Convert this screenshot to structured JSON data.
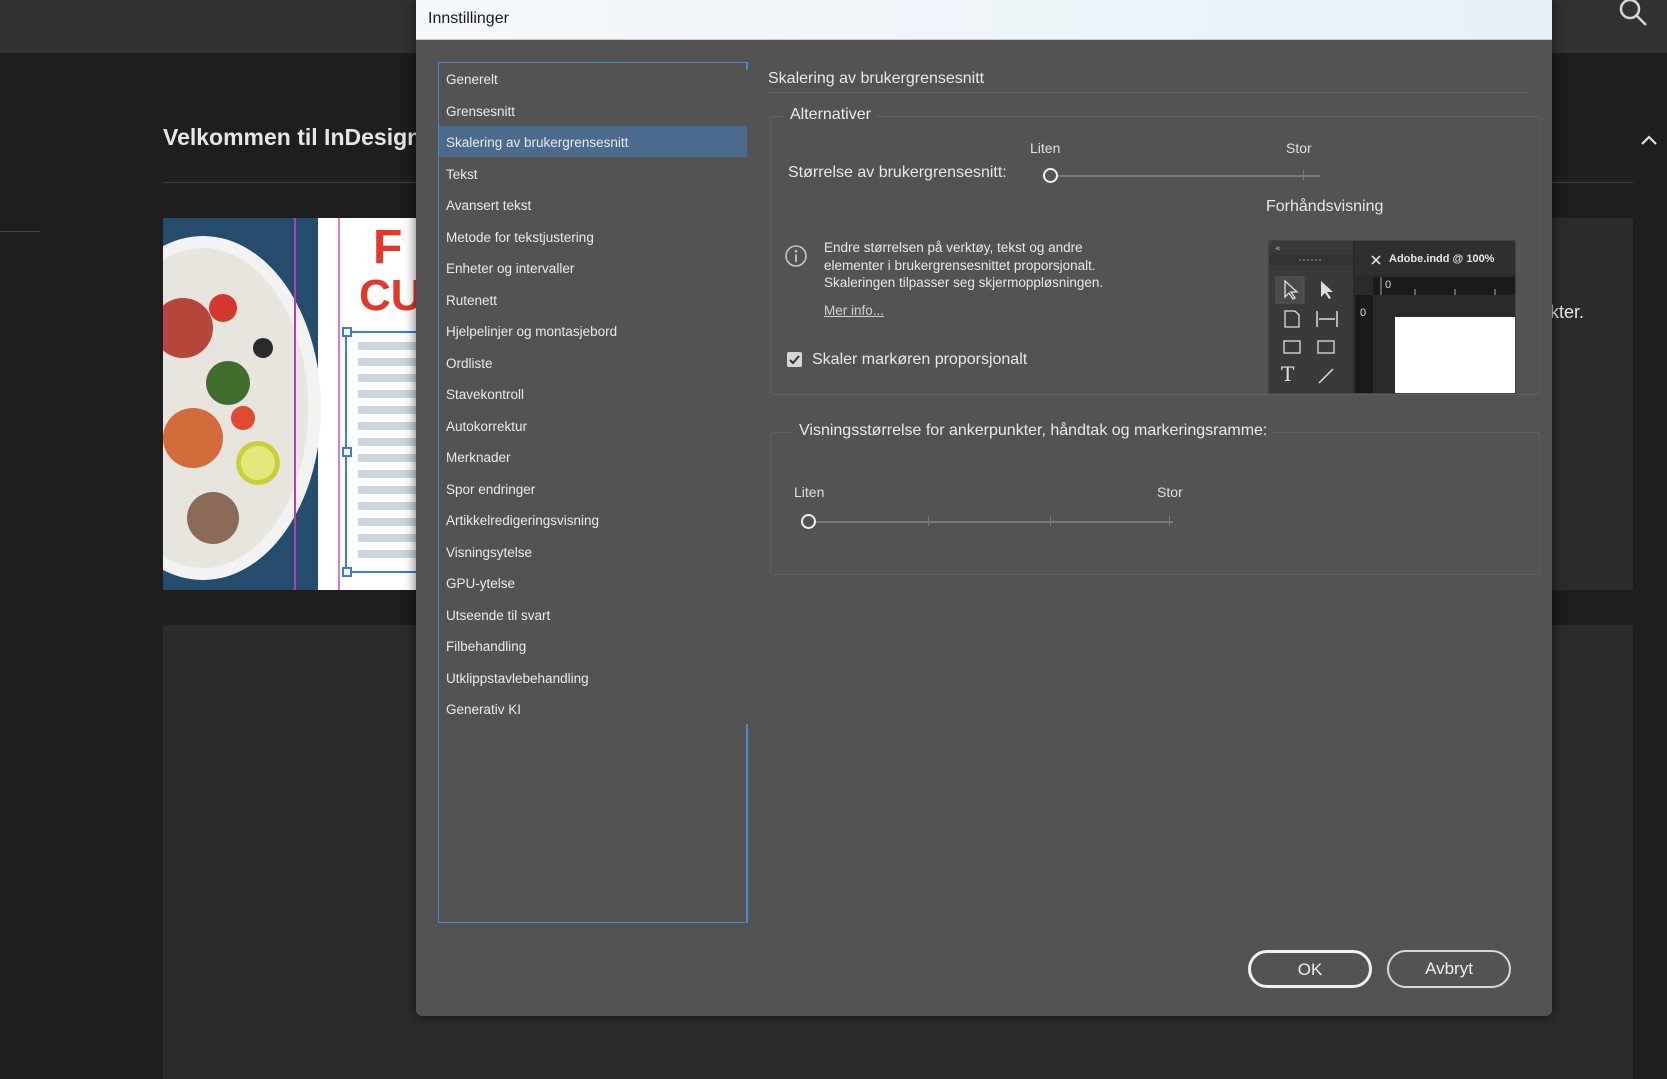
{
  "background": {
    "welcome_title": "Velkommen til InDesign,",
    "hero_text_fragment": "ekter."
  },
  "dialog": {
    "title": "Innstillinger",
    "categories": [
      "Generelt",
      "Grensesnitt",
      "Skalering av brukergrensesnitt",
      "Tekst",
      "Avansert tekst",
      "Metode for tekstjustering",
      "Enheter og intervaller",
      "Rutenett",
      "Hjelpelinjer og montasjebord",
      "Ordliste",
      "Stavekontroll",
      "Autokorrektur",
      "Merknader",
      "Spor endringer",
      "Artikkelredigeringsvisning",
      "Visningsytelse",
      "GPU-ytelse",
      "Utseende til svart",
      "Filbehandling",
      "Utklippstavlebehandling",
      "Generativ KI"
    ],
    "selected_category_index": 2,
    "section_heading": "Skalering av brukergrensesnitt",
    "options_group": {
      "label": "Alternativer",
      "slider_min_label": "Liten",
      "slider_max_label": "Stor",
      "size_label": "Størrelse av brukergrensesnitt:",
      "slider_value_fraction": 0.0,
      "preview_label": "Forhåndsvisning",
      "info_lines": [
        "Endre størrelsen på verktøy, tekst og andre",
        "elementer i brukergrensesnittet proporsjonalt.",
        "Skaleringen tilpasser seg skjermoppløsningen."
      ],
      "more_info_link": "Mer info...",
      "scale_cursor_label": "Skaler markøren proporsjonalt",
      "scale_cursor_checked": true,
      "preview_tab": "Adobe.indd @ 100%",
      "preview_ruler_zero": "0"
    },
    "anchor_group": {
      "label": "Visningsstørrelse for ankerpunkter, håndtak og markeringsramme:",
      "slider_min_label": "Liten",
      "slider_max_label": "Stor",
      "slider_value_fraction": 0.0
    },
    "buttons": {
      "ok": "OK",
      "cancel": "Avbryt"
    }
  }
}
